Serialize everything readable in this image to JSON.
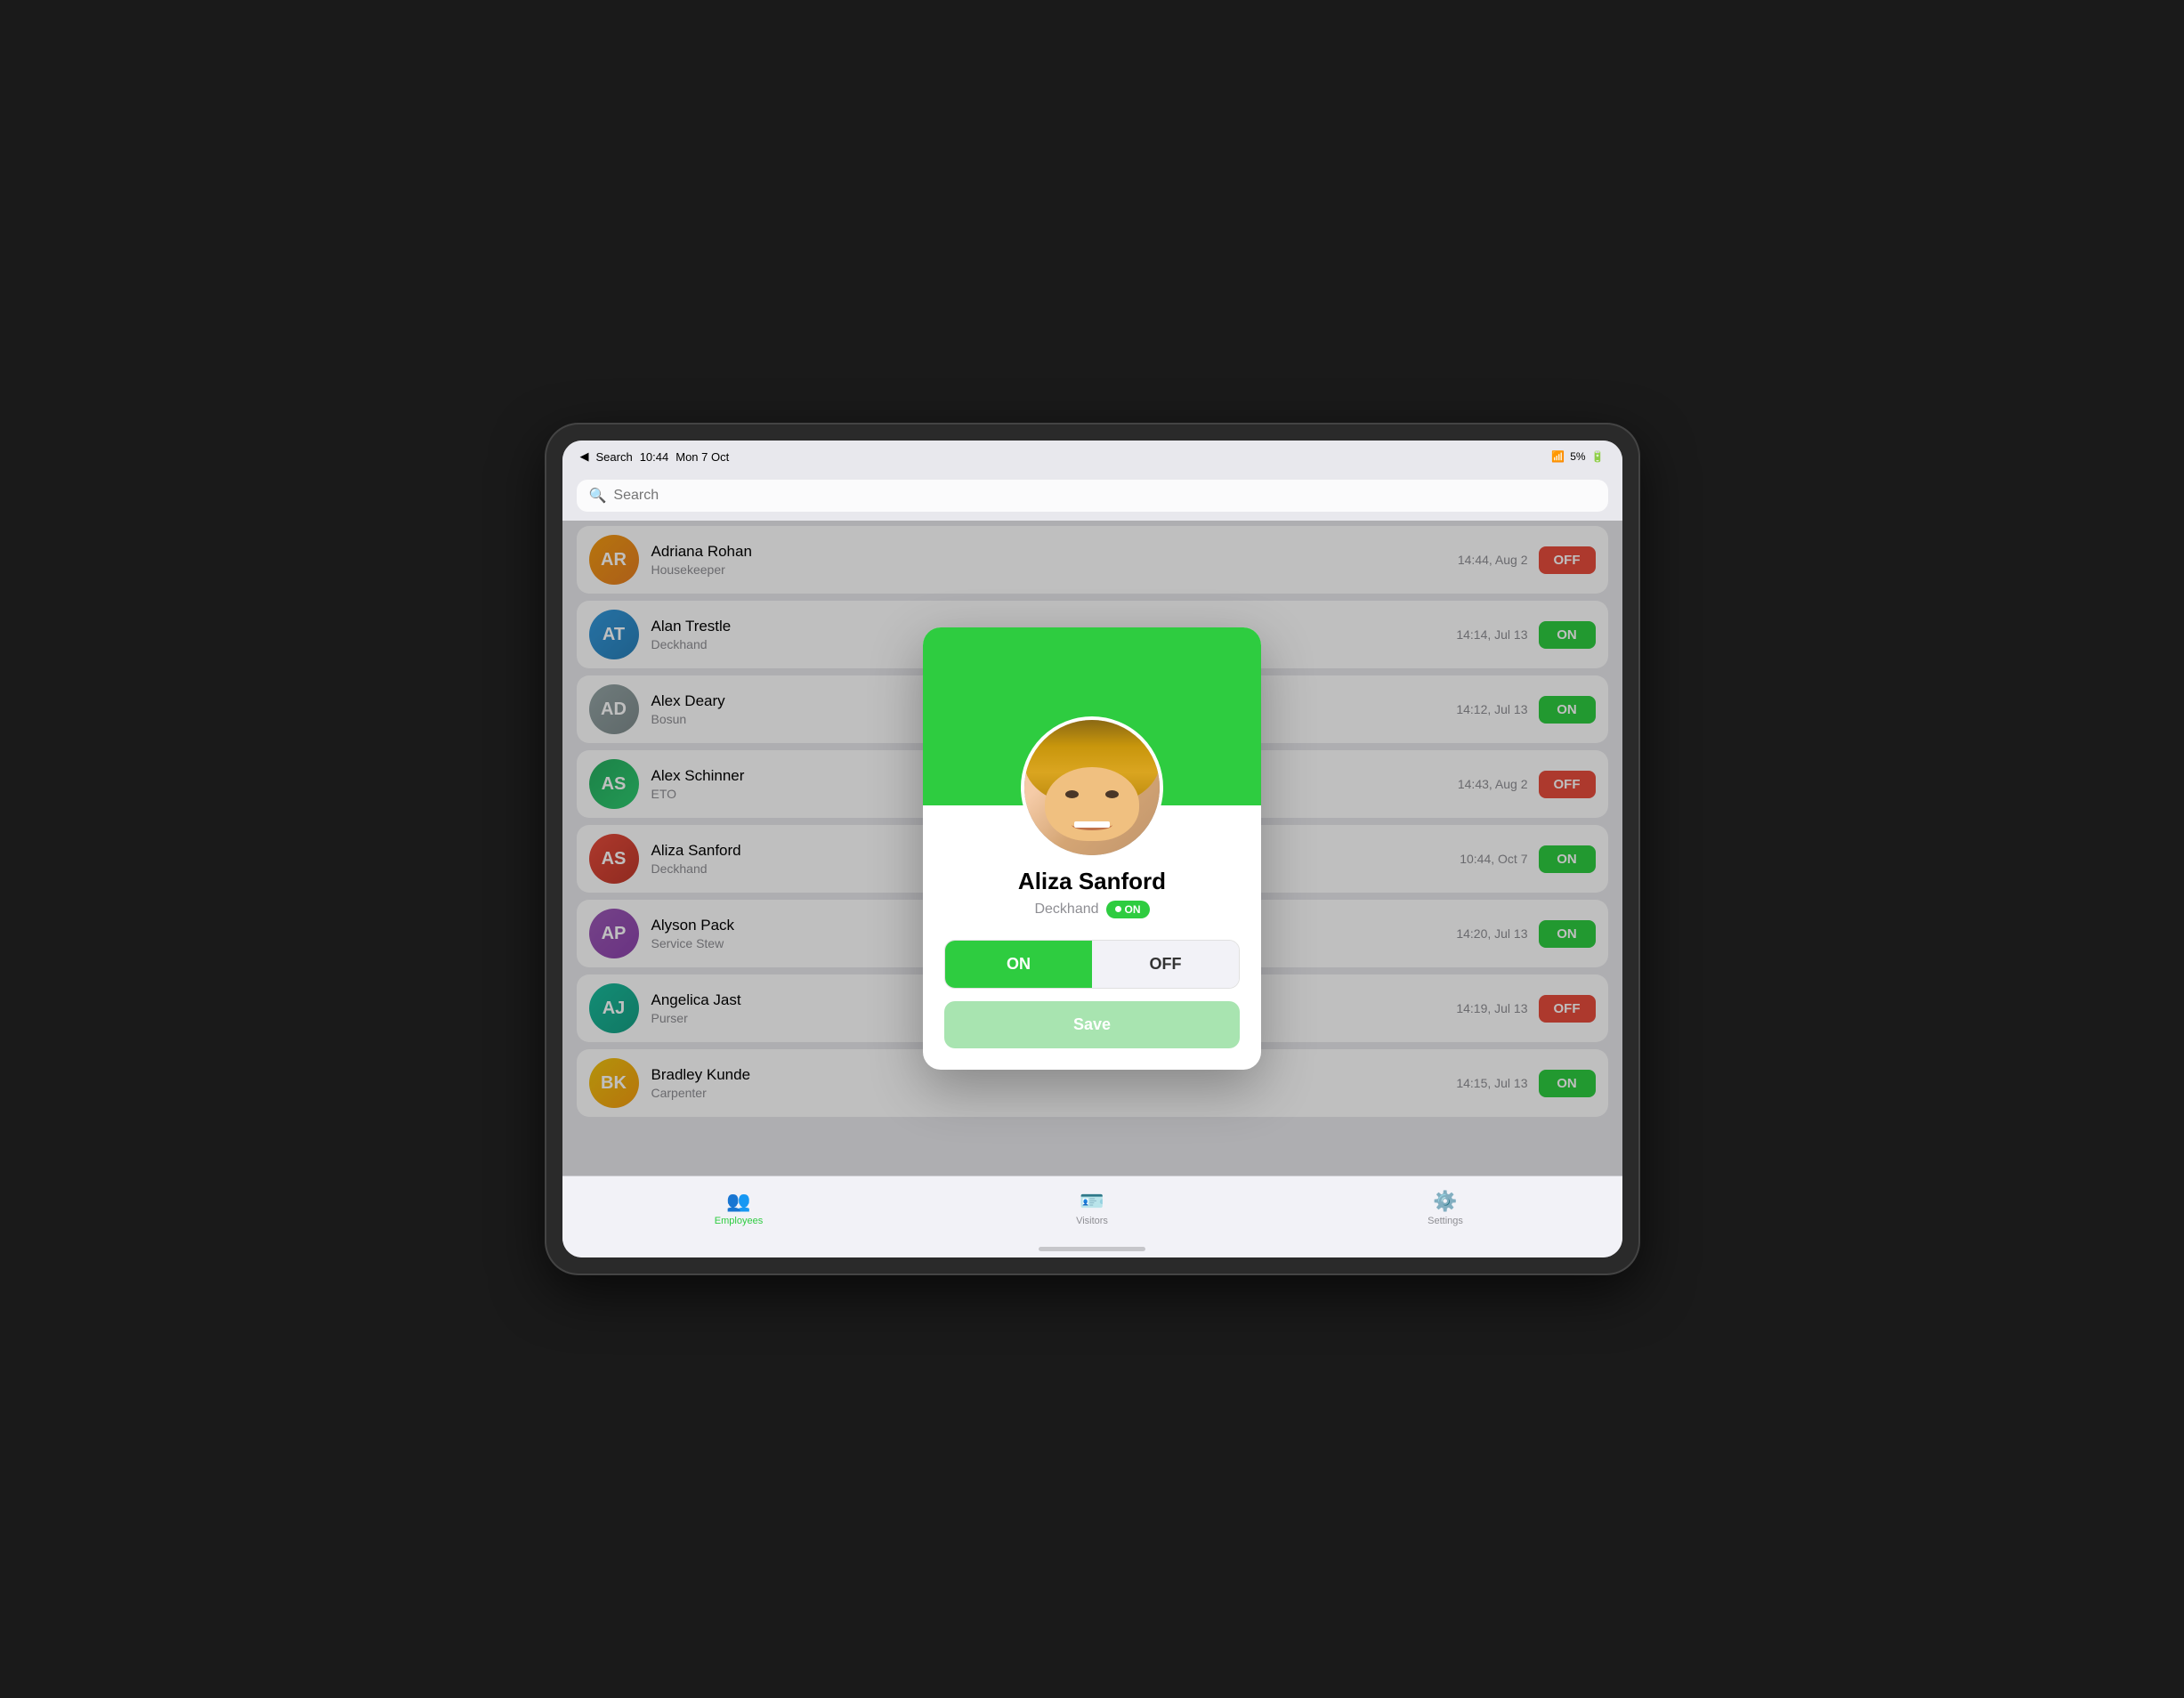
{
  "status_bar": {
    "back_label": "Search",
    "time": "10:44",
    "date": "Mon 7 Oct",
    "wifi_icon": "wifi",
    "battery_percent": "5%",
    "battery_icon": "battery"
  },
  "search": {
    "placeholder": "Search"
  },
  "employees": [
    {
      "id": 1,
      "name": "Adriana Rohan",
      "role": "Housekeeper",
      "time": "14:44, Aug 2",
      "status": "OFF",
      "avatar_class": "av-1",
      "initial": "AR"
    },
    {
      "id": 2,
      "name": "Alan Trestle",
      "role": "Deckhand",
      "time": "14:14, Jul 13",
      "status": "ON",
      "avatar_class": "av-2",
      "initial": "AT"
    },
    {
      "id": 3,
      "name": "Alex Deary",
      "role": "Bosun",
      "time": "14:12, Jul 13",
      "status": "ON",
      "avatar_class": "av-3",
      "initial": "AD"
    },
    {
      "id": 4,
      "name": "Alex Schinner",
      "role": "ETO",
      "time": "14:43, Aug 2",
      "status": "OFF",
      "avatar_class": "av-4",
      "initial": "AS"
    },
    {
      "id": 5,
      "name": "Aliza Sanford",
      "role": "Deckhand",
      "time": "10:44, Oct 7",
      "status": "ON",
      "avatar_class": "av-5",
      "initial": "AS"
    },
    {
      "id": 6,
      "name": "Alyson Pack",
      "role": "Service Stew",
      "time": "14:20, Jul 13",
      "status": "ON",
      "avatar_class": "av-6",
      "initial": "AP"
    },
    {
      "id": 7,
      "name": "Angelica Jast",
      "role": "Purser",
      "time": "14:19, Jul 13",
      "status": "OFF",
      "avatar_class": "av-7",
      "initial": "AJ"
    },
    {
      "id": 8,
      "name": "Bradley Kunde",
      "role": "Carpenter",
      "time": "14:15, Jul 13",
      "status": "ON",
      "avatar_class": "av-8",
      "initial": "BK"
    }
  ],
  "modal": {
    "name": "Aliza Sanford",
    "role": "Deckhand",
    "status_label": "ON",
    "on_button_label": "ON",
    "off_button_label": "OFF",
    "save_button_label": "Save"
  },
  "tabs": [
    {
      "id": "employees",
      "label": "Employees",
      "icon": "👥",
      "active": true
    },
    {
      "id": "visitors",
      "label": "Visitors",
      "icon": "🪪",
      "active": false
    },
    {
      "id": "settings",
      "label": "Settings",
      "icon": "⚙️",
      "active": false
    }
  ],
  "colors": {
    "on_green": "#2ecc40",
    "off_red": "#e74c3c",
    "active_tab": "#2ecc40"
  }
}
